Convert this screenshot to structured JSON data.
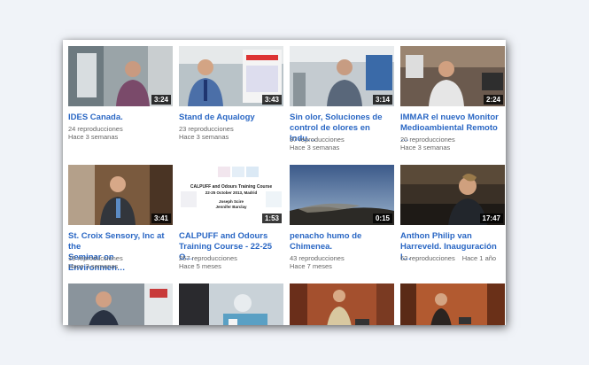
{
  "videos": [
    {
      "title": "IDES Canada.",
      "views": "24 reproducciones",
      "age": "Hace 3 semanas",
      "duration": "3:24",
      "meta_inline": false
    },
    {
      "title": "Stand de Aqualogy",
      "views": "23 reproducciones",
      "age": "Hace 3 semanas",
      "duration": "3:43",
      "meta_inline": false
    },
    {
      "title": "Sin olor, Soluciones de\ncontrol de olores en Indu…",
      "views": "97 reproducciones",
      "age": "Hace 3 semanas",
      "duration": "3:14",
      "meta_inline": false
    },
    {
      "title": "IMMAR el nuevo Monitor\nMedioambiental Remoto …",
      "views": "20 reproducciones",
      "age": "Hace 3 semanas",
      "duration": "2:24",
      "meta_inline": false
    },
    {
      "title": "St. Croix Sensory, Inc at the\nSeminar on Environmen…",
      "views": "19 reproducciones",
      "age": "Hace 3 semanas",
      "duration": "3:41",
      "meta_inline": false
    },
    {
      "title": "CALPUFF and Odours\nTraining Course - 22-25 O…",
      "views": "257 reproducciones",
      "age": "Hace 5 meses",
      "duration": "1:53",
      "meta_inline": false,
      "thumb_text": {
        "line1": "CALPUFF and Odours Training Course",
        "line2": "22-25 October 2013, Madrid",
        "line3": "Joseph Scire",
        "line4": "Jennifer Barclay"
      }
    },
    {
      "title": "penacho humo de\nChimenea.",
      "views": "43 reproducciones",
      "age": "Hace 7 meses",
      "duration": "0:15",
      "meta_inline": false
    },
    {
      "title": "Anthon Philip van\nHarreveld. Inauguración I…",
      "views": "62 reproducciones",
      "age": "Hace 1 año",
      "duration": "17:47",
      "meta_inline": true
    },
    {
      "title": "",
      "views": "",
      "age": "",
      "duration": "",
      "meta_inline": false
    },
    {
      "title": "",
      "views": "",
      "age": "",
      "duration": "",
      "meta_inline": false
    },
    {
      "title": "",
      "views": "",
      "age": "",
      "duration": "",
      "meta_inline": false
    },
    {
      "title": "",
      "views": "",
      "age": "",
      "duration": "",
      "meta_inline": false
    }
  ]
}
